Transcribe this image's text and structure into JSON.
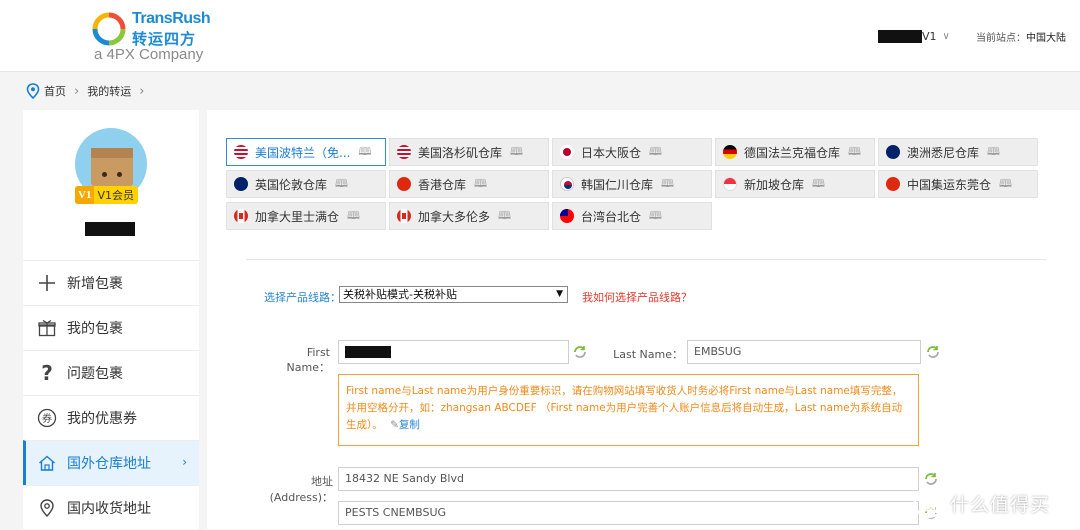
{
  "header": {
    "logo_en": "TransRush",
    "logo_cn": "转运四方",
    "logo_sub": "a 4PX Company",
    "user_level": "V1",
    "site_label": "当前站点：",
    "site_value": "中国大陆"
  },
  "breadcrumb": [
    "首页",
    "我的转运"
  ],
  "sidebar": {
    "vip_tag": "V1",
    "vip_label": "V1会员",
    "menu": [
      {
        "label": "新增包裹",
        "icon": "plus-icon"
      },
      {
        "label": "我的包裹",
        "icon": "gift-icon"
      },
      {
        "label": "问题包裹",
        "icon": "question-icon"
      },
      {
        "label": "我的优惠券",
        "icon": "coupon-icon"
      },
      {
        "label": "国外仓库地址",
        "icon": "house-icon",
        "active": true
      },
      {
        "label": "国内收货地址",
        "icon": "location-icon"
      }
    ]
  },
  "warehouses": [
    {
      "label": "美国波特兰（免...",
      "flag": "us",
      "active": true
    },
    {
      "label": "美国洛杉矶仓库",
      "flag": "us"
    },
    {
      "label": "日本大阪仓",
      "flag": "jp"
    },
    {
      "label": "德国法兰克福仓库",
      "flag": "de"
    },
    {
      "label": "澳洲悉尼仓库",
      "flag": "au"
    },
    {
      "label": "英国伦敦仓库",
      "flag": "uk"
    },
    {
      "label": "香港仓库",
      "flag": "hk"
    },
    {
      "label": "韩国仁川仓库",
      "flag": "kr"
    },
    {
      "label": "新加坡仓库",
      "flag": "sg"
    },
    {
      "label": "中国集运东莞仓",
      "flag": "cn"
    },
    {
      "label": "加拿大里士满仓",
      "flag": "ca"
    },
    {
      "label": "加拿大多伦多",
      "flag": "ca"
    },
    {
      "label": "台湾台北仓",
      "flag": "tw"
    }
  ],
  "route": {
    "label": "选择产品线路：",
    "selected": "关税补贴模式-关税补贴",
    "help": "我如何选择产品线路？"
  },
  "form": {
    "first_name_label": "First Name：",
    "last_name_label": "Last Name：",
    "last_name_value": "EMBSUG",
    "notice": "First name与Last name为用户身份重要标识，请在购物网站填写收货人时务必将First name与Last name填写完整，并用空格分开，如：zhangsan ABCDEF （First name为用户完善个人账户信息后将自动生成，Last name为系统自动生成）。",
    "notice_copy": "复制",
    "address_label": "地址(Address)：",
    "address1": "18432 NE Sandy Blvd",
    "address2": "PESTS CNEMBSUG"
  },
  "watermark": {
    "icon_text": "值",
    "text": "什么值得买"
  },
  "colors": {
    "accent": "#1a7ed2",
    "warning": "#f08a1a",
    "link_red": "#e03a2a"
  }
}
